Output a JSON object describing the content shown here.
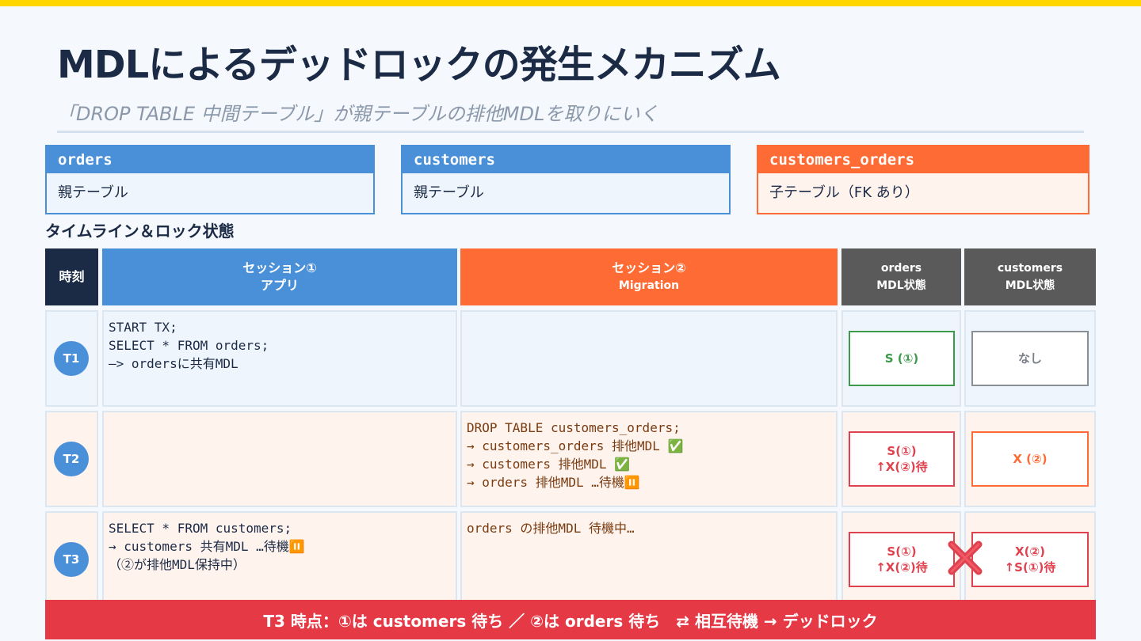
{
  "title": "MDLによるデッドロックの発生メカニズム",
  "subtitle": "「DROP TABLE 中間テーブル」が親テーブルの排他MDLを取りにいく",
  "cards": [
    {
      "name": "orders",
      "desc": "親テーブル"
    },
    {
      "name": "customers",
      "desc": "親テーブル"
    },
    {
      "name": "customers_orders",
      "desc": "子テーブル（FK あり）"
    }
  ],
  "section_label": "タイムライン＆ロック状態",
  "headers": {
    "time": "時刻",
    "session1_line1": "セッション①",
    "session1_line2": "アプリ",
    "session2_line1": "セッション②",
    "session2_line2": "Migration",
    "orders_line1": "orders",
    "orders_line2": "MDL状態",
    "customers_line1": "customers",
    "customers_line2": "MDL状態"
  },
  "rows": [
    {
      "time": "T1",
      "session1": "START TX;\nSELECT * FROM orders;\n—> ordersに共有MDL",
      "session2": "",
      "orders_lock": {
        "line1": "S (①)",
        "line2": ""
      },
      "customers_lock": {
        "line1": "なし",
        "line2": ""
      }
    },
    {
      "time": "T2",
      "session1": "",
      "session2": "DROP TABLE customers_orders;\n→ customers_orders 排他MDL ✅\n→ customers 排他MDL ✅\n→ orders 排他MDL …待機⏸️",
      "orders_lock": {
        "line1": "S(①)",
        "line2": "↑X(②)待"
      },
      "customers_lock": {
        "line1": "X (②)",
        "line2": ""
      }
    },
    {
      "time": "T3",
      "session1": "SELECT * FROM customers;\n→ customers 共有MDL …待機⏸️\n（②が排他MDL保持中）",
      "session2": "orders の排他MDL 待機中…",
      "orders_lock": {
        "line1": "S(①)",
        "line2": "↑X(②)待"
      },
      "customers_lock": {
        "line1": "X(②)",
        "line2": "↑S(①)待"
      }
    }
  ],
  "footer": "T3 時点：①は customers 待ち ／ ②は orders 待ち　⇄ 相互待機 → デッドロック",
  "colors": {
    "accent_yellow": "#ffd600",
    "navy": "#1b2a45",
    "blue": "#4a90d9",
    "orange": "#ff6b35",
    "gray_header": "#5a5a5a",
    "red": "#e53946",
    "green": "#3c9a4a"
  },
  "icons": {
    "deadlock_marker": "red-x-icon"
  }
}
